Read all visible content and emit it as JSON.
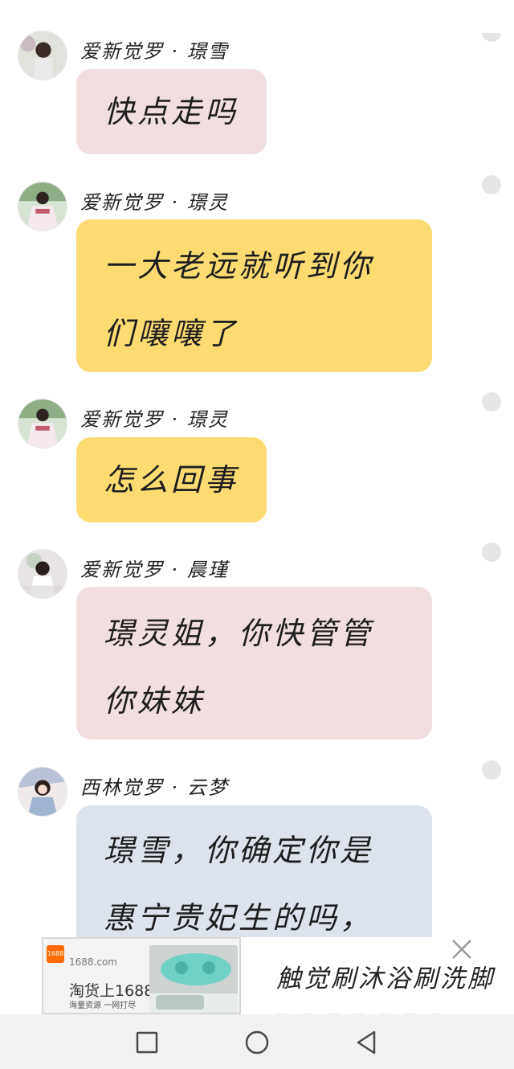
{
  "messages": [
    {
      "sender": "爱新觉罗 · 璟雪",
      "lines": [
        "快点走吗"
      ],
      "color": "#f1dfe0"
    },
    {
      "sender": "爱新觉罗 · 璟灵",
      "lines": [
        "一大老远就听到你",
        "们嚷嚷了"
      ],
      "color": "#fddb72"
    },
    {
      "sender": "爱新觉罗 · 璟灵",
      "lines": [
        "怎么回事"
      ],
      "color": "#fddb72"
    },
    {
      "sender": "爱新觉罗 · 晨瑾",
      "lines": [
        "璟灵姐，你快管管",
        "你妹妹"
      ],
      "color": "#f1dfe0"
    },
    {
      "sender": "西林觉罗 · 云梦",
      "lines": [
        "璟雪，你确定你是",
        "惠宁贵妃生的吗，"
      ],
      "color": "#dde3ed"
    }
  ],
  "ad": {
    "logo": "1688",
    "domain": "1688.com",
    "brand": "淘货上1688",
    "slogan": "海量资源 一网打尽",
    "title": "触觉刷沐浴刷洗脚",
    "close_icon": "close-icon"
  },
  "navbar": {
    "recent_icon": "square-icon",
    "home_icon": "circle-icon",
    "back_icon": "triangle-back-icon"
  }
}
